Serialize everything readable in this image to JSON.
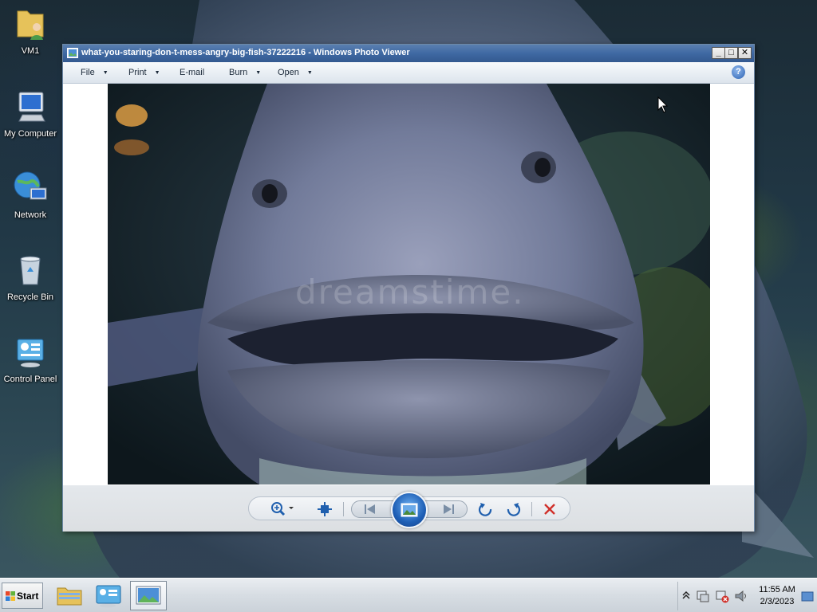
{
  "desktop": {
    "icons": [
      {
        "label": "VM1"
      },
      {
        "label": "My Computer"
      },
      {
        "label": "Network"
      },
      {
        "label": "Recycle Bin"
      },
      {
        "label": "Control Panel"
      }
    ]
  },
  "viewer": {
    "title": "what-you-staring-don-t-mess-angry-big-fish-37222216 - Windows Photo Viewer",
    "caption_buttons": {
      "minimize": "_",
      "maximize": "□",
      "close": "✕"
    },
    "menu": [
      {
        "label": "File",
        "has_dropdown": true
      },
      {
        "label": "Print",
        "has_dropdown": true
      },
      {
        "label": "E-mail",
        "has_dropdown": false
      },
      {
        "label": "Burn",
        "has_dropdown": true
      },
      {
        "label": "Open",
        "has_dropdown": true
      }
    ],
    "help_label": "?",
    "photo_watermark": "dreamstime.",
    "controls": [
      "zoom",
      "actual-size",
      "previous",
      "slideshow",
      "next",
      "rotate-counterclockwise",
      "rotate-clockwise",
      "delete"
    ]
  },
  "taskbar": {
    "start_label": "Start",
    "items": [
      "explorer",
      "control-panel",
      "photo-viewer"
    ],
    "active_item": "photo-viewer"
  },
  "tray": {
    "time": "11:55 AM",
    "date": "2/3/2023"
  },
  "colors": {
    "titlebar": "#3f69a3",
    "delete_red": "#d0302a",
    "slideshow_blue": "#1e5fb6"
  }
}
